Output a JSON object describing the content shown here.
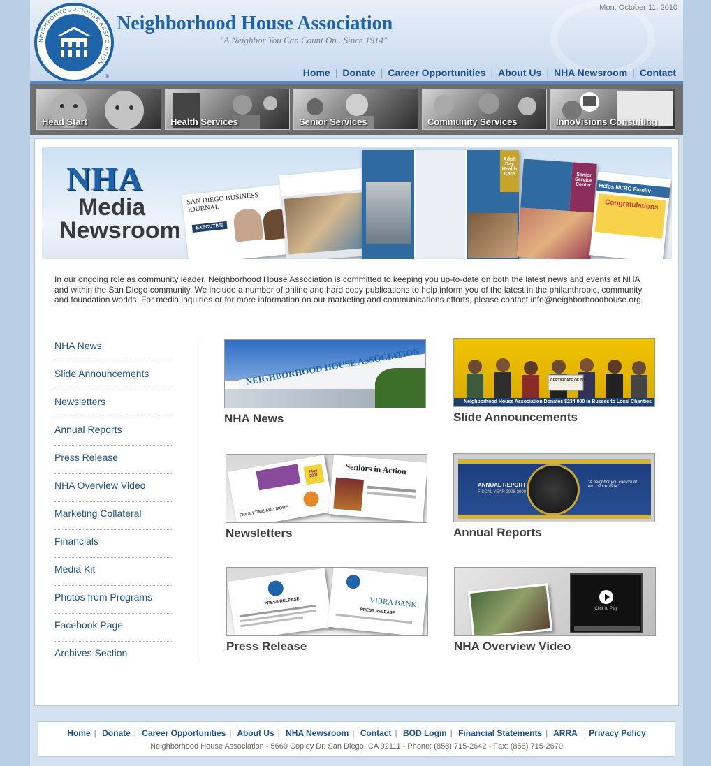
{
  "header": {
    "site_name": "Neighborhood House Association",
    "tagline": "\"A Neighbor You Can Count On...Since 1914\"",
    "date": "Mon, October 11, 2010",
    "logo_text": "NEIGHBORHOOD HOUSE ASSOCIATION",
    "nav": [
      "Home",
      "Donate",
      "Career Opportunities",
      "About Us",
      "NHA Newsroom",
      "Contact"
    ]
  },
  "services": [
    "Head Start",
    "Health Services",
    "Senior Services",
    "Community Services",
    "InnoVisions Consulting"
  ],
  "banner": {
    "nha": "NHA",
    "title_line1": "Media",
    "title_line2": "Newsroom",
    "pub_newspaper": "SAN DIEGO BUSINESS JOURNAL",
    "pub_executive": "EXECUTIVE",
    "pub_adult_day": "Adult Day Health Care",
    "pub_senior": "Senior Service Center",
    "pub_helps": "Helps NCRC Family",
    "pub_congrats": "Congratulations"
  },
  "intro": "In our ongoing role as community leader, Neighborhood House Association is committed to keeping you up-to-date on both the latest news and events at NHA and within the San Diego community. We include a number of online and hard copy publications to help inform you of the latest in the philanthropic, community and foundation worlds. For media inquiries or for more information on our marketing and communications efforts, please contact info@neighborhoodhouse.org.",
  "sidenav": [
    "NHA News",
    "Slide Announcements",
    "Newsletters",
    "Annual Reports",
    "Press Release",
    "NHA Overview Video",
    "Marketing Collateral",
    "Financials",
    "Media Kit",
    "Photos from Programs",
    "Facebook Page",
    "Archives Section"
  ],
  "tiles": {
    "news": {
      "label": "NHA News",
      "sign": "NEIGHBORHOOD HOUSE ASSOCIATION"
    },
    "slides": {
      "label": "Slide Announcements",
      "caption": "Neighborhood House Association Donates $234,000 in Busses to Local Charities",
      "certificate": "CERTIFICATE OF TITLE"
    },
    "newsletters": {
      "label": "Newsletters",
      "headline": "Seniors in Action",
      "month": "May 2010",
      "item1": "FRESH TIME AND MORE"
    },
    "reports": {
      "label": "Annual Reports",
      "title": "ANNUAL REPORT",
      "subtitle": "FISCAL YEAR 2008-2009",
      "quote": "\"A neighbor you can count on... since 1914\""
    },
    "press": {
      "label": "Press Release",
      "doc1": "PRESS RELEASE",
      "doc2": "VIBRA BANK",
      "doc2_sub": "PRESS RELEASE"
    },
    "video": {
      "label": "NHA Overview Video",
      "play": "Click to Play"
    }
  },
  "footer": {
    "nav": [
      "Home",
      "Donate",
      "Career Opportunities",
      "About Us",
      "NHA Newsroom",
      "Contact",
      "BOD Login",
      "Financial Statements",
      "ARRA",
      "Privacy Policy"
    ],
    "address": "Neighborhood House Association - 5660 Copley Dr. San Diego, CA 92111 - Phone: (858) 715-2642 - Fax: (858) 715-2670"
  },
  "colors": {
    "brand_blue": "#1f63a9",
    "link_blue": "#1a4f8f",
    "page_bg": "#b9cfe6"
  }
}
